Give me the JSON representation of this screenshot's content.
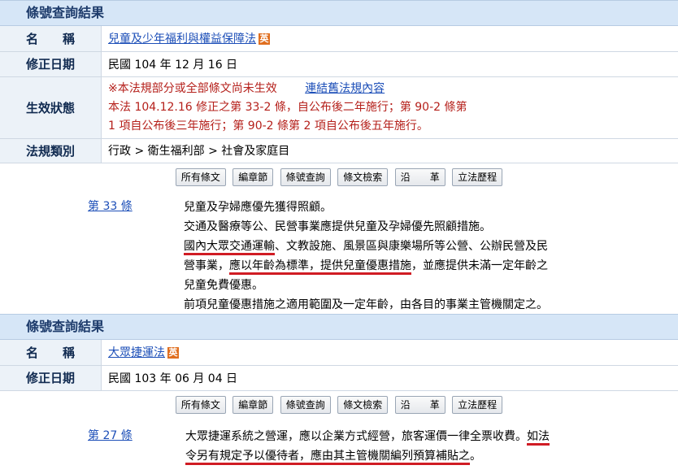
{
  "top": {
    "header": "條號查詢結果",
    "rows": {
      "name_label": "名　　稱",
      "name_value": "兒童及少年福利與權益保障法",
      "en_badge": "英",
      "date_label": "修正日期",
      "date_value": "民國 104 年 12 月 16 日",
      "status_label": "生效狀態",
      "status_line1": "※本法規部分或全部條文尚未生效",
      "status_link": "連結舊法規內容",
      "status_line2": "本法 104.12.16 修正之第 33-2 條，自公布後二年施行；第 90-2 條第",
      "status_line3": "1 項自公布後三年施行；第 90-2 條第 2 項自公布後五年施行。",
      "category_label": "法規類別",
      "category_value": "行政 > 衛生福利部 > 社會及家庭目"
    },
    "buttons": [
      "所有條文",
      "編章節",
      "條號查詢",
      "條文檢索",
      "沿　　革",
      "立法歷程"
    ],
    "article_no": "第 33 條",
    "article_lines": [
      "兒童及孕婦應優先獲得照顧。",
      "交通及醫療等公、民營事業應提供兒童及孕婦優先照顧措施。",
      "國內大眾交通運輸",
      "、文教設施、風景區與康樂場所等公營、公辦民營及民",
      "營事業，",
      "應以年齡為標準，提供兒童優惠措施",
      "，並應提供未滿一定年齡之",
      "兒童免費優惠。",
      "前項兒童優惠措施之適用範圍及一定年齡，由各目的事業主管機關定之。"
    ]
  },
  "bottom": {
    "header": "條號查詢結果",
    "rows": {
      "name_label": "名　　稱",
      "name_value": "大眾捷運法",
      "en_badge": "英",
      "date_label": "修正日期",
      "date_value": "民國 103 年 06 月 04 日"
    },
    "buttons": [
      "所有條文",
      "編章節",
      "條號查詢",
      "條文檢索",
      "沿　　革",
      "立法歷程"
    ],
    "article_no": "第 27 條",
    "article_line1a": "大眾捷運系統之營運，應以企業方式經營，旅客運價一律全票收費。",
    "article_line1b": "如法",
    "article_line2a": "令另有規定予以優待者，應由其主管機關編列預算補貼之",
    "article_line2b": "。"
  }
}
